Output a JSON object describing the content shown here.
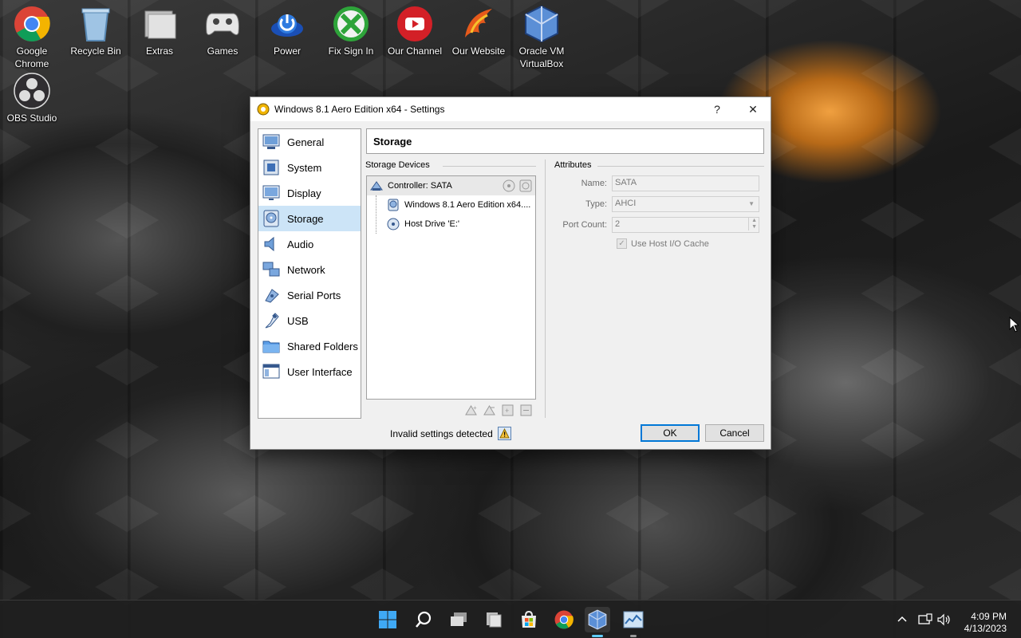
{
  "desktop": {
    "icons": [
      {
        "label": "Google Chrome",
        "icon": "chrome-icon"
      },
      {
        "label": "Recycle Bin",
        "icon": "recycle-bin-icon"
      },
      {
        "label": "Extras",
        "icon": "folder-icon"
      },
      {
        "label": "Games",
        "icon": "gamepad-icon"
      },
      {
        "label": "Power",
        "icon": "power-icon"
      },
      {
        "label": "Fix Sign In",
        "icon": "xbox-icon"
      },
      {
        "label": "Our Channel",
        "icon": "youtube-icon"
      },
      {
        "label": "Our Website",
        "icon": "phoenix-icon"
      },
      {
        "label": "Oracle VM VirtualBox",
        "icon": "virtualbox-icon"
      },
      {
        "label": "OBS Studio",
        "icon": "obs-icon"
      }
    ]
  },
  "dialog": {
    "title": "Windows 8.1 Aero Edition x64 - Settings",
    "help_label": "?",
    "close_label": "✕",
    "nav": [
      {
        "label": "General",
        "icon": "general-icon"
      },
      {
        "label": "System",
        "icon": "system-icon"
      },
      {
        "label": "Display",
        "icon": "display-icon"
      },
      {
        "label": "Storage",
        "icon": "storage-icon",
        "selected": true
      },
      {
        "label": "Audio",
        "icon": "audio-icon"
      },
      {
        "label": "Network",
        "icon": "network-icon"
      },
      {
        "label": "Serial Ports",
        "icon": "serial-ports-icon"
      },
      {
        "label": "USB",
        "icon": "usb-icon"
      },
      {
        "label": "Shared Folders",
        "icon": "shared-folders-icon"
      },
      {
        "label": "User Interface",
        "icon": "user-interface-icon"
      }
    ],
    "page_title": "Storage",
    "storage_devices_label": "Storage Devices",
    "attributes_label": "Attributes",
    "tree": {
      "controller": "Controller: SATA",
      "children": [
        {
          "label": "Windows 8.1 Aero Edition x64....",
          "icon": "hard-disk-icon"
        },
        {
          "label": "Host Drive 'E:'",
          "icon": "optical-disc-icon"
        }
      ]
    },
    "attributes": {
      "name_label": "Name:",
      "name_value": "SATA",
      "type_label": "Type:",
      "type_value": "AHCI",
      "port_count_label": "Port Count:",
      "port_count_value": "2",
      "host_io_cache_label": "Use Host I/O Cache",
      "host_io_cache_checked": true
    },
    "status_text": "Invalid settings detected",
    "ok_label": "OK",
    "cancel_label": "Cancel"
  },
  "taskbar": {
    "icons": [
      "start-icon",
      "search-icon",
      "task-view-icon",
      "file-explorer-icon",
      "store-icon",
      "chrome-icon",
      "virtualbox-icon",
      "task-manager-icon"
    ],
    "time": "4:09 PM",
    "date": "4/13/2023"
  }
}
